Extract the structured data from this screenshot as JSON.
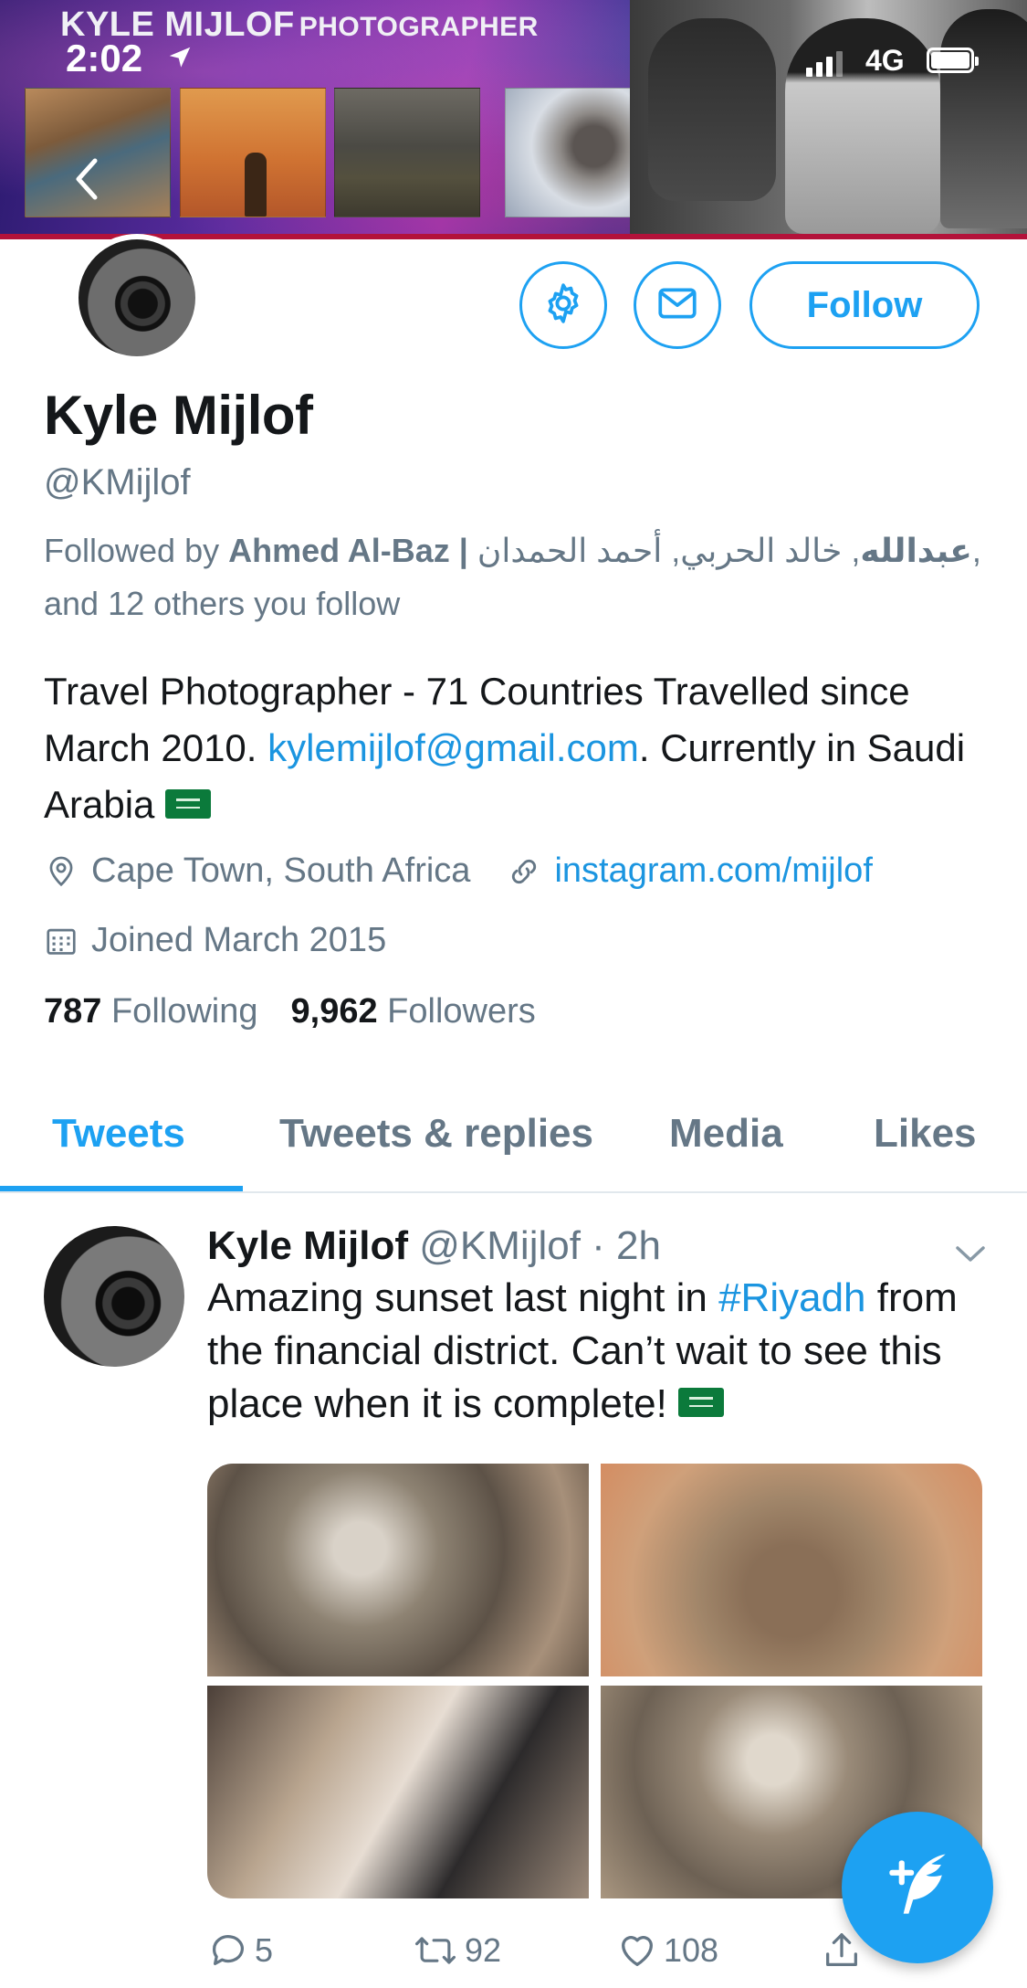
{
  "status_bar": {
    "time": "2:02",
    "network": "4G"
  },
  "banner": {
    "title_big": "KYLE MIJLOF",
    "title_small": "PHOTOGRAPHER"
  },
  "profile": {
    "display_name": "Kyle Mijlof",
    "handle": "@KMijlof",
    "follow_label": "Follow",
    "followed_by_prefix": "Followed by ",
    "followed_by_names": "Ahmed Al-Baz | عبدالله",
    "followed_by_rest": ", خالد الحربي, أحمد الحمدان",
    "followed_by_suffix": ", and 12 others you follow",
    "bio_part1": "Travel Photographer - 71 Countries Travelled since March 2010. ",
    "bio_email": "kylemijlof@gmail.com",
    "bio_part2": ". Currently in Saudi Arabia ",
    "location": "Cape Town, South Africa",
    "website": "instagram.com/mijlof",
    "joined": "Joined March 2015",
    "following_count": "787",
    "following_label": "Following",
    "followers_count": "9,962",
    "followers_label": "Followers"
  },
  "tabs": [
    "Tweets",
    "Tweets & replies",
    "Media",
    "Likes"
  ],
  "tweet": {
    "author": "Kyle Mijlof",
    "handle_time": "@KMijlof · 2h",
    "text_part1": "Amazing sunset last night in ",
    "hashtag": "#Riyadh",
    "text_part2": " from the financial district. Can’t wait to see this place when it is complete! ",
    "replies": "5",
    "retweets": "92",
    "likes": "108"
  },
  "colors": {
    "accent": "#1da1f2",
    "link": "#1b95e0",
    "muted": "#657786",
    "text": "#14171a"
  },
  "icons": [
    "location-arrow-icon",
    "back-chevron-icon",
    "gear-icon",
    "mail-icon",
    "location-pin-icon",
    "link-icon",
    "calendar-icon",
    "chevron-down-icon",
    "reply-icon",
    "retweet-icon",
    "like-icon",
    "share-icon",
    "compose-tweet-icon"
  ]
}
